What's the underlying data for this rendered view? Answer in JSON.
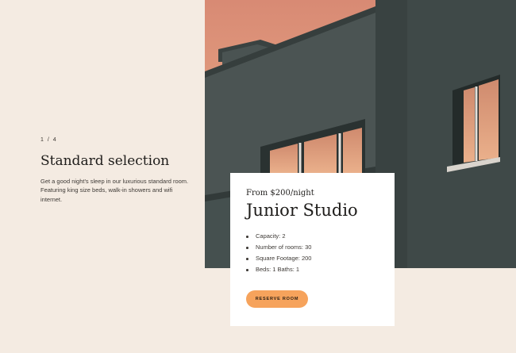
{
  "slider": {
    "counter": "1 / 4"
  },
  "intro": {
    "title": "Standard selection",
    "description": "Get a good night's sleep in our luxurious standard room. Featuring king size beds, walk-in showers and wifi internet."
  },
  "room": {
    "price": "From $200/night",
    "name": "Junior Studio",
    "features": [
      "Capacity: 2",
      "Number of rooms: 30",
      "Square Footage: 200",
      "Beds: 1 Baths: 1"
    ],
    "cta_label": "RESERVE ROOM"
  },
  "colors": {
    "background": "#f4ebe2",
    "card": "#ffffff",
    "accent": "#f6a35c",
    "building": "#3f4948",
    "sky": "#e9a882"
  }
}
